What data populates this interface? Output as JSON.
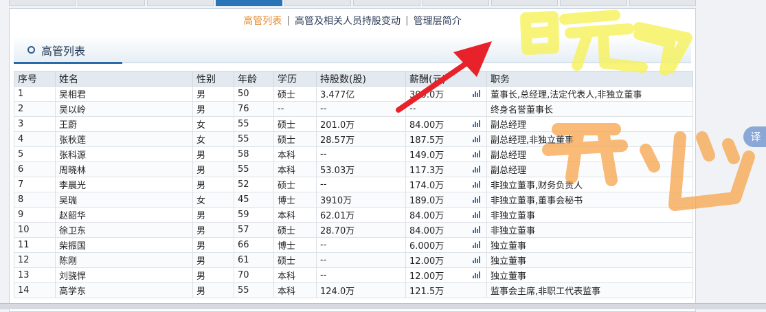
{
  "subnav": {
    "items": [
      "高管列表",
      "高管及相关人员持股变动",
      "管理层简介"
    ],
    "separator": "|"
  },
  "section": {
    "title": "高管列表"
  },
  "table": {
    "headers": [
      "序号",
      "姓名",
      "性别",
      "年龄",
      "学历",
      "持股数(股)",
      "薪酬(元)",
      "职务"
    ],
    "rows": [
      {
        "no": "1",
        "name": "吴相君",
        "gender": "男",
        "age": "50",
        "edu": "硕士",
        "shares": "3.477亿",
        "salary": "300.0万",
        "title": "董事长,总经理,法定代表人,非独立董事",
        "chart": true
      },
      {
        "no": "2",
        "name": "吴以岭",
        "gender": "男",
        "age": "76",
        "edu": "--",
        "shares": "--",
        "salary": "--",
        "title": "终身名誉董事长",
        "chart": false
      },
      {
        "no": "3",
        "name": "王蔚",
        "gender": "女",
        "age": "55",
        "edu": "硕士",
        "shares": "201.0万",
        "salary": "84.00万",
        "title": "副总经理",
        "chart": true
      },
      {
        "no": "4",
        "name": "张秋莲",
        "gender": "女",
        "age": "55",
        "edu": "硕士",
        "shares": "28.57万",
        "salary": "187.5万",
        "title": "副总经理,非独立董事",
        "chart": true
      },
      {
        "no": "5",
        "name": "张科源",
        "gender": "男",
        "age": "58",
        "edu": "本科",
        "shares": "--",
        "salary": "149.0万",
        "title": "副总经理",
        "chart": true
      },
      {
        "no": "6",
        "name": "周晓林",
        "gender": "男",
        "age": "55",
        "edu": "本科",
        "shares": "53.03万",
        "salary": "117.3万",
        "title": "副总经理",
        "chart": true
      },
      {
        "no": "7",
        "name": "李晨光",
        "gender": "男",
        "age": "52",
        "edu": "硕士",
        "shares": "--",
        "salary": "174.0万",
        "title": "非独立董事,财务负责人",
        "chart": true
      },
      {
        "no": "8",
        "name": "吴瑞",
        "gender": "女",
        "age": "45",
        "edu": "博士",
        "shares": "3910万",
        "salary": "189.0万",
        "title": "非独立董事,董事会秘书",
        "chart": true
      },
      {
        "no": "9",
        "name": "赵韶华",
        "gender": "男",
        "age": "59",
        "edu": "本科",
        "shares": "62.01万",
        "salary": "84.00万",
        "title": "非独立董事",
        "chart": true
      },
      {
        "no": "10",
        "name": "徐卫东",
        "gender": "男",
        "age": "57",
        "edu": "硕士",
        "shares": "28.70万",
        "salary": "84.00万",
        "title": "非独立董事",
        "chart": true
      },
      {
        "no": "11",
        "name": "柴振国",
        "gender": "男",
        "age": "66",
        "edu": "博士",
        "shares": "--",
        "salary": "6.000万",
        "title": "独立董事",
        "chart": true
      },
      {
        "no": "12",
        "name": "陈刚",
        "gender": "男",
        "age": "61",
        "edu": "硕士",
        "shares": "--",
        "salary": "12.00万",
        "title": "独立董事",
        "chart": true
      },
      {
        "no": "13",
        "name": "刘骁悍",
        "gender": "男",
        "age": "70",
        "edu": "本科",
        "shares": "--",
        "salary": "12.00万",
        "title": "独立董事",
        "chart": true
      },
      {
        "no": "14",
        "name": "高学东",
        "gender": "男",
        "age": "55",
        "edu": "本科",
        "shares": "124.0万",
        "salary": "121.5万",
        "title": "监事会主席,非职工代表监事",
        "chart": false
      }
    ]
  },
  "annotations": {
    "arrow_color": "#e8222a",
    "yellow_scribble_color": "#f7f25a",
    "orange_scribble_color": "#f7a44a"
  },
  "floating": {
    "translate_label": "译"
  }
}
